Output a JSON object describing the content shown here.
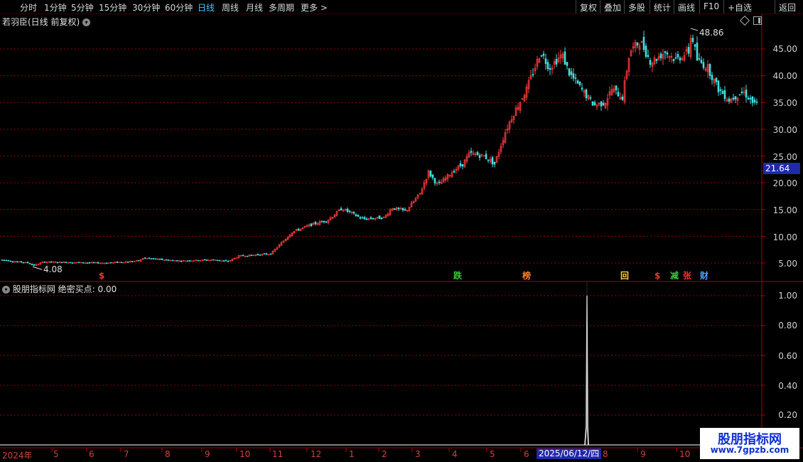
{
  "toolbar": {
    "periods": [
      "分时",
      "1分钟",
      "5分钟",
      "15分钟",
      "30分钟",
      "60分钟",
      "日线",
      "周线",
      "月线",
      "多周期",
      "更多 >"
    ],
    "active": "日线",
    "right_buttons": [
      "复权",
      "叠加",
      "多股",
      "统计",
      "画线",
      "F10",
      "+自选",
      "返回"
    ]
  },
  "main_panel": {
    "title": "若羽臣(日线 前复权)",
    "last_price_tag": "21.64",
    "high_label": "48.86",
    "low_label": "4.08",
    "y_axis": [
      "45.00",
      "40.00",
      "35.00",
      "30.00",
      "25.00",
      "20.00",
      "15.00",
      "10.00",
      "5.00"
    ],
    "markers": [
      {
        "text": "$",
        "color": "#ff3030"
      },
      {
        "text": "跌",
        "color": "#30d030"
      },
      {
        "text": "榜",
        "color": "#ff8030"
      },
      {
        "text": "回",
        "color": "#ffd040"
      },
      {
        "text": "$",
        "color": "#ff3030"
      },
      {
        "text": "减",
        "color": "#30d030"
      },
      {
        "text": "张",
        "color": "#ff3030"
      },
      {
        "text": "财",
        "color": "#4fa0ff"
      }
    ]
  },
  "sub_panel": {
    "title": "股朋指标网",
    "indicator_name": "绝密买点:",
    "indicator_value": "0.00",
    "y_axis": [
      "1.00",
      "0.80",
      "0.60",
      "0.40",
      "0.20"
    ]
  },
  "date_axis": {
    "labels": [
      "2024年",
      "5",
      "6",
      "7",
      "8",
      "9",
      "10",
      "11",
      "12",
      "1",
      "2",
      "3",
      "4",
      "5",
      "6",
      "8",
      "9",
      "10"
    ],
    "highlight": "2025/06/12/四"
  },
  "watermark": {
    "line1": "股朋指标网",
    "line2": "www.7gpzb.com"
  },
  "colors": {
    "up": "#ff3c3c",
    "down": "#40e0e0",
    "grid": "#8a0000",
    "axis": "#b00000"
  },
  "chart_data": {
    "type": "candlestick",
    "title": "若羽臣(日线 前复权)",
    "ylim": [
      3,
      49
    ],
    "close_path": [
      [
        0,
        5.6
      ],
      [
        20,
        5.3
      ],
      [
        40,
        5.0
      ],
      [
        46,
        4.5
      ],
      [
        60,
        5.2
      ],
      [
        100,
        5.1
      ],
      [
        150,
        5.0
      ],
      [
        195,
        5.4
      ],
      [
        200,
        5.9
      ],
      [
        250,
        5.4
      ],
      [
        300,
        5.6
      ],
      [
        320,
        5.3
      ],
      [
        335,
        6.3
      ],
      [
        380,
        6.7
      ],
      [
        410,
        10.8
      ],
      [
        440,
        12.3
      ],
      [
        460,
        13.0
      ],
      [
        480,
        15.2
      ],
      [
        510,
        13.2
      ],
      [
        540,
        13.5
      ],
      [
        550,
        15.3
      ],
      [
        570,
        14.7
      ],
      [
        590,
        18.0
      ],
      [
        602,
        22.0
      ],
      [
        615,
        19.5
      ],
      [
        635,
        22.0
      ],
      [
        650,
        23.5
      ],
      [
        660,
        25.5
      ],
      [
        680,
        25.0
      ],
      [
        695,
        23.5
      ],
      [
        710,
        29.5
      ],
      [
        720,
        32.5
      ],
      [
        740,
        37.5
      ],
      [
        760,
        44.5
      ],
      [
        772,
        41.5
      ],
      [
        790,
        44.0
      ],
      [
        800,
        40.5
      ],
      [
        820,
        37.0
      ],
      [
        835,
        34.5
      ],
      [
        850,
        35.0
      ],
      [
        860,
        37.5
      ],
      [
        875,
        36.0
      ],
      [
        885,
        44.5
      ],
      [
        900,
        46.5
      ],
      [
        915,
        42.5
      ],
      [
        935,
        44.5
      ],
      [
        950,
        43.0
      ],
      [
        968,
        44.5
      ],
      [
        972,
        48.0
      ],
      [
        980,
        43.0
      ],
      [
        995,
        41.5
      ],
      [
        1010,
        37.5
      ],
      [
        1025,
        35.5
      ],
      [
        1045,
        37.0
      ],
      [
        1062,
        34.5
      ],
      [
        1066,
        35.0
      ]
    ],
    "sub_series": {
      "name": "绝密买点",
      "signal_at_date": "2025/06/12",
      "signal_value": 1.0
    }
  }
}
